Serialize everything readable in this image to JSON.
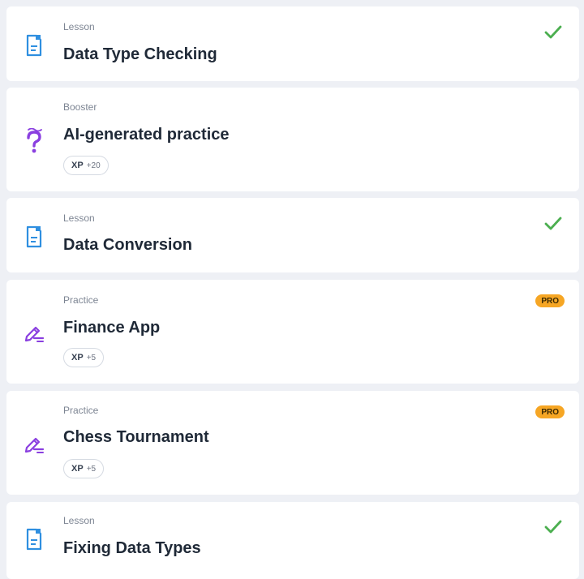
{
  "colors": {
    "background": "#eef0f5",
    "card": "#ffffff",
    "lesson_icon": "#2f8fe0",
    "booster_icon": "#8a3fe0",
    "practice_icon": "#8a3fe0",
    "check": "#4caf50",
    "pro_badge": "#f6a624"
  },
  "items": [
    {
      "kind": "Lesson",
      "title": "Data Type Checking",
      "icon": "document-icon",
      "completed": true
    },
    {
      "kind": "Booster",
      "title": "AI-generated practice",
      "icon": "question-icon",
      "xp_label": "XP",
      "xp_value": "+20"
    },
    {
      "kind": "Lesson",
      "title": "Data Conversion",
      "icon": "document-icon",
      "completed": true
    },
    {
      "kind": "Practice",
      "title": "Finance App",
      "icon": "pencil-icon",
      "badge": "PRO",
      "xp_label": "XP",
      "xp_value": "+5"
    },
    {
      "kind": "Practice",
      "title": "Chess Tournament",
      "icon": "pencil-icon",
      "badge": "PRO",
      "xp_label": "XP",
      "xp_value": "+5"
    },
    {
      "kind": "Lesson",
      "title": "Fixing Data Types",
      "icon": "document-icon",
      "completed": true
    }
  ]
}
